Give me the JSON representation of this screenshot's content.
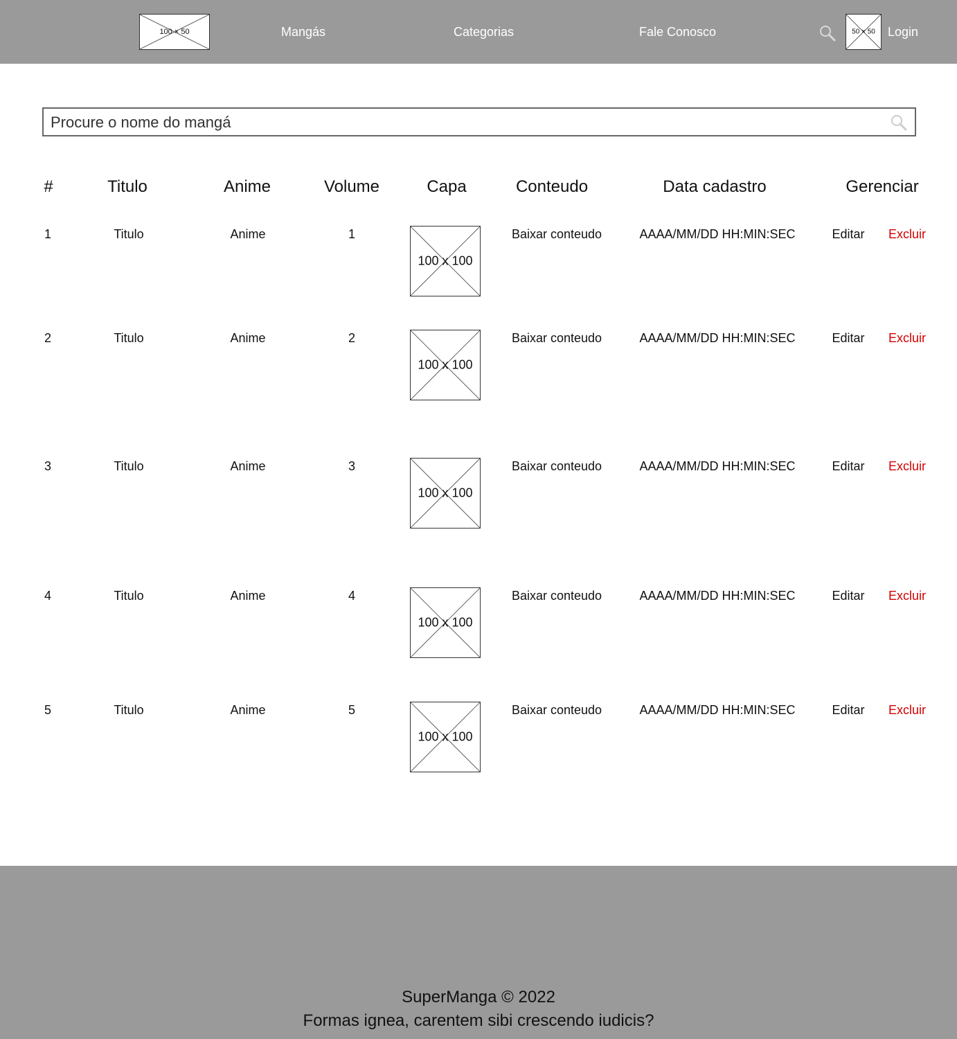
{
  "header": {
    "logo_placeholder": "100 × 50",
    "nav": [
      "Mangás",
      "Categorias",
      "Fale Conosco"
    ],
    "avatar_placeholder": "50 × 50",
    "login_label": "Login"
  },
  "search": {
    "placeholder": "Procure o nome do mangá",
    "value": ""
  },
  "table": {
    "columns": [
      "#",
      "Titulo",
      "Anime",
      "Volume",
      "Capa",
      "Conteudo",
      "Data cadastro",
      "Gerenciar"
    ],
    "rows": [
      {
        "num": "1",
        "titulo": "Titulo",
        "anime": "Anime",
        "volume": "1",
        "capa": "100 x 100",
        "conteudo": "Baixar conteudo",
        "data": "AAAA/MM/DD  HH:MIN:SEC",
        "editar": "Editar",
        "excluir": "Excluir"
      },
      {
        "num": "2",
        "titulo": "Titulo",
        "anime": "Anime",
        "volume": "2",
        "capa": "100 x 100",
        "conteudo": "Baixar conteudo",
        "data": "AAAA/MM/DD  HH:MIN:SEC",
        "editar": "Editar",
        "excluir": "Excluir"
      },
      {
        "num": "3",
        "titulo": "Titulo",
        "anime": "Anime",
        "volume": "3",
        "capa": "100 x 100",
        "conteudo": "Baixar conteudo",
        "data": "AAAA/MM/DD  HH:MIN:SEC",
        "editar": "Editar",
        "excluir": "Excluir"
      },
      {
        "num": "4",
        "titulo": "Titulo",
        "anime": "Anime",
        "volume": "4",
        "capa": "100 x 100",
        "conteudo": "Baixar conteudo",
        "data": "AAAA/MM/DD  HH:MIN:SEC",
        "editar": "Editar",
        "excluir": "Excluir"
      },
      {
        "num": "5",
        "titulo": "Titulo",
        "anime": "Anime",
        "volume": "5",
        "capa": "100 x 100",
        "conteudo": "Baixar conteudo",
        "data": "AAAA/MM/DD  HH:MIN:SEC",
        "editar": "Editar",
        "excluir": "Excluir"
      }
    ]
  },
  "footer": {
    "copyright": "SuperManga © 2022",
    "tagline": "Formas ignea, carentem sibi crescendo iudicis?"
  },
  "colors": {
    "bar_bg": "#9a9a9a",
    "danger": "#d40000",
    "nav_text": "#ffffff"
  }
}
